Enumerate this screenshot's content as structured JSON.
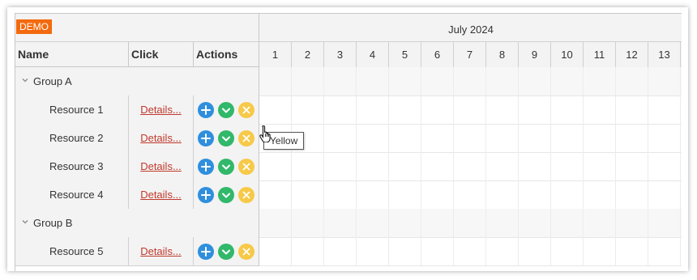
{
  "badge": "DEMO",
  "header": {
    "month": "July 2024",
    "columns": {
      "name": "Name",
      "click": "Click",
      "actions": "Actions"
    },
    "days": [
      "1",
      "2",
      "3",
      "4",
      "5",
      "6",
      "7",
      "8",
      "9",
      "10",
      "11",
      "12",
      "13"
    ]
  },
  "rows": [
    {
      "type": "group",
      "label": "Group A"
    },
    {
      "type": "resource",
      "label": "Resource 1",
      "link": "Details..."
    },
    {
      "type": "resource",
      "label": "Resource 2",
      "link": "Details..."
    },
    {
      "type": "resource",
      "label": "Resource 3",
      "link": "Details..."
    },
    {
      "type": "resource",
      "label": "Resource 4",
      "link": "Details..."
    },
    {
      "type": "group",
      "label": "Group B"
    },
    {
      "type": "resource",
      "label": "Resource 5",
      "link": "Details..."
    }
  ],
  "actions": [
    {
      "icon": "plus-icon",
      "color": "#2f8fde"
    },
    {
      "icon": "check-chevron-icon",
      "color": "#31b86a"
    },
    {
      "icon": "close-icon",
      "color": "#f7c948"
    }
  ],
  "tooltip": "Yellow",
  "colors": {
    "badge": "#f36a0e",
    "link": "#c0392b"
  }
}
